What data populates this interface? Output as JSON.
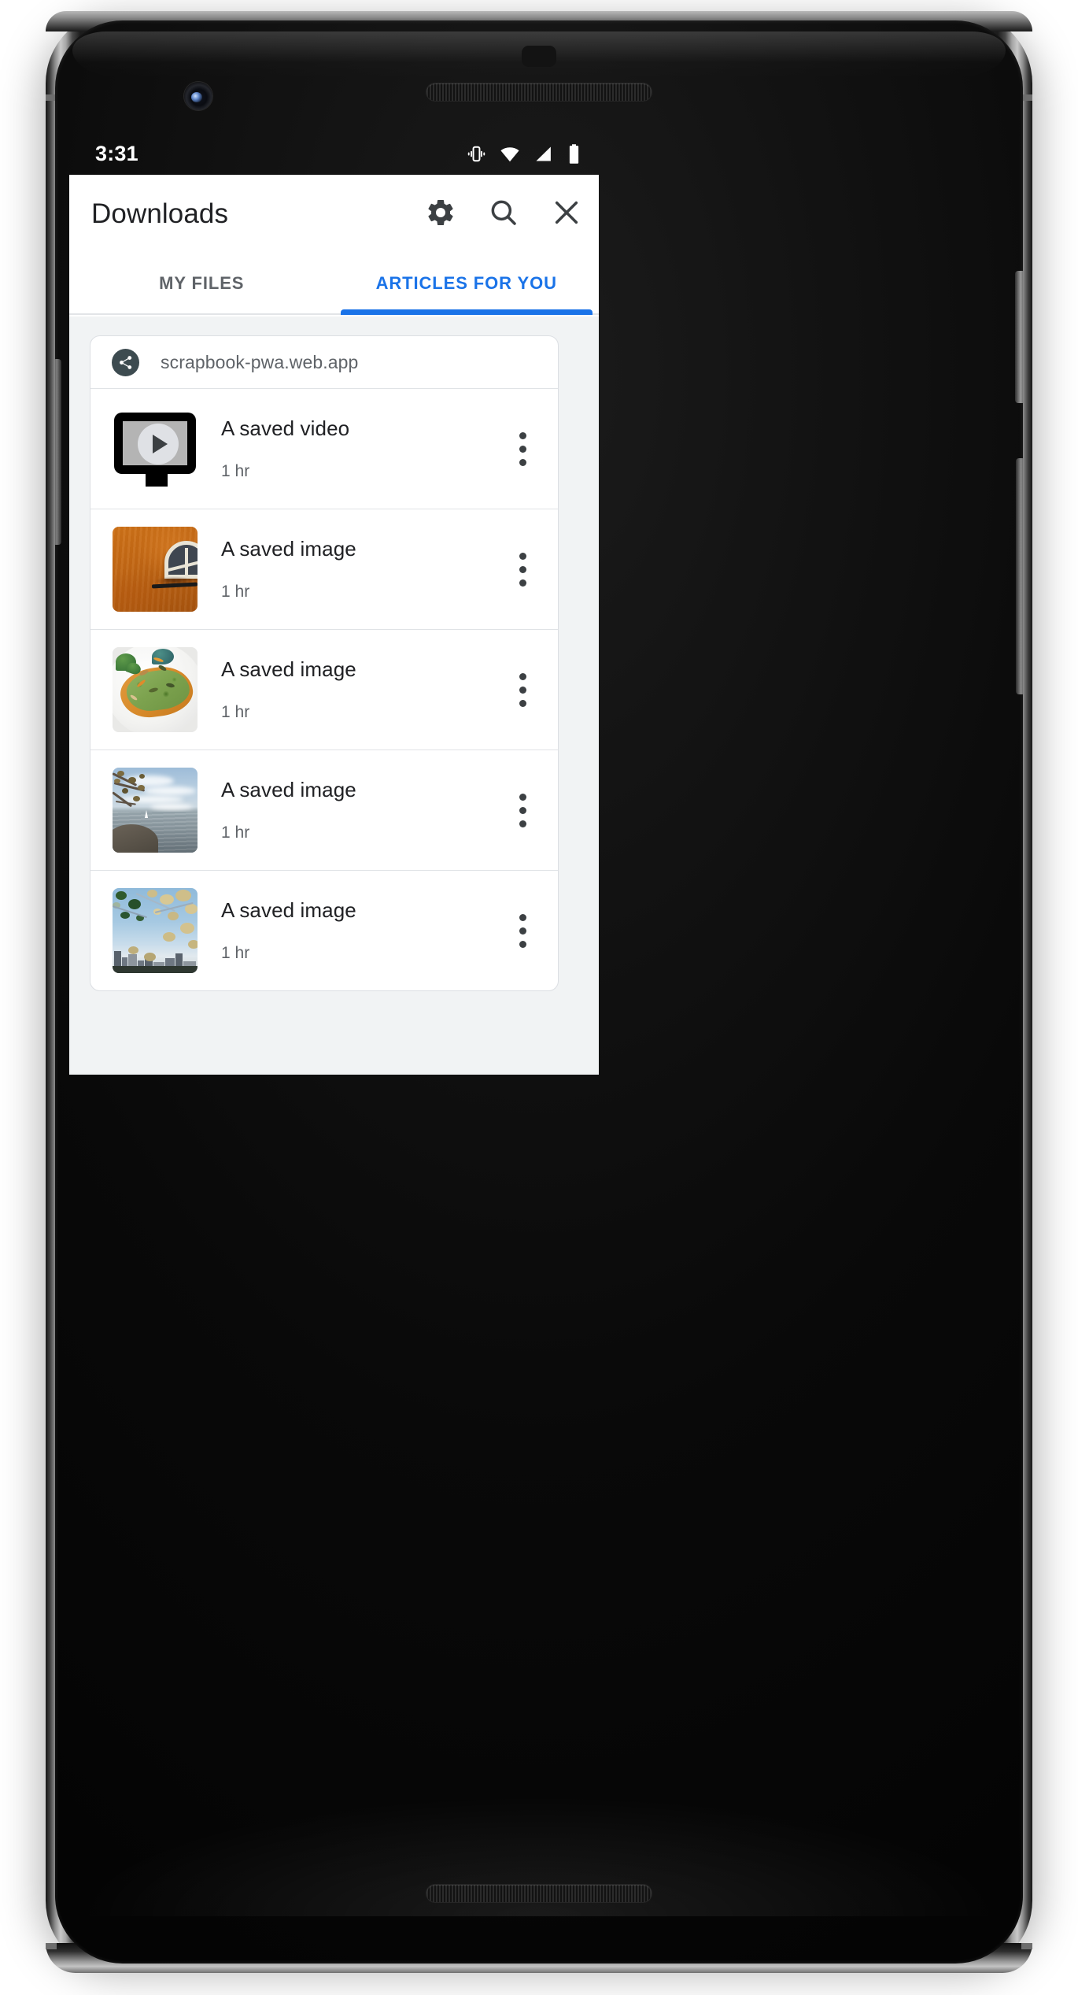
{
  "status_bar": {
    "time": "3:31",
    "icons": [
      "vibrate-icon",
      "wifi-icon",
      "cellular-signal-icon",
      "battery-icon"
    ]
  },
  "app_bar": {
    "title": "Downloads",
    "actions": [
      {
        "name": "settings-icon",
        "label": "Settings"
      },
      {
        "name": "search-icon",
        "label": "Search"
      },
      {
        "name": "close-icon",
        "label": "Close"
      }
    ]
  },
  "tabs": {
    "items": [
      {
        "label": "MY FILES",
        "active": false
      },
      {
        "label": "ARTICLES FOR YOU",
        "active": true
      }
    ],
    "active_color": "#1a73e8",
    "inactive_color": "#5f6368"
  },
  "card": {
    "origin": {
      "icon": "share-icon",
      "text": "scrapbook-pwa.web.app",
      "chip_color": "#3d4b50"
    },
    "items": [
      {
        "title": "A saved video",
        "time": "1 hr",
        "thumb": "video-player-icon",
        "menu": "overflow-menu-icon"
      },
      {
        "title": "A saved image",
        "time": "1 hr",
        "thumb": "photo-orange-wall",
        "menu": "overflow-menu-icon"
      },
      {
        "title": "A saved image",
        "time": "1 hr",
        "thumb": "photo-avocado-toast",
        "menu": "overflow-menu-icon"
      },
      {
        "title": "A saved image",
        "time": "1 hr",
        "thumb": "photo-lake-shore",
        "menu": "overflow-menu-icon"
      },
      {
        "title": "A saved image",
        "time": "1 hr",
        "thumb": "photo-city-blossom",
        "menu": "overflow-menu-icon"
      }
    ]
  },
  "device": {
    "parts": [
      "front-camera-icon",
      "earpiece-speaker",
      "bottom-speaker",
      "power-button",
      "volume-button"
    ]
  },
  "colors": {
    "accent": "#1a73e8",
    "text_primary": "#202124",
    "text_secondary": "#5f6368",
    "surface": "#ffffff",
    "background": "#f1f3f4",
    "divider": "#e0e3e6"
  }
}
